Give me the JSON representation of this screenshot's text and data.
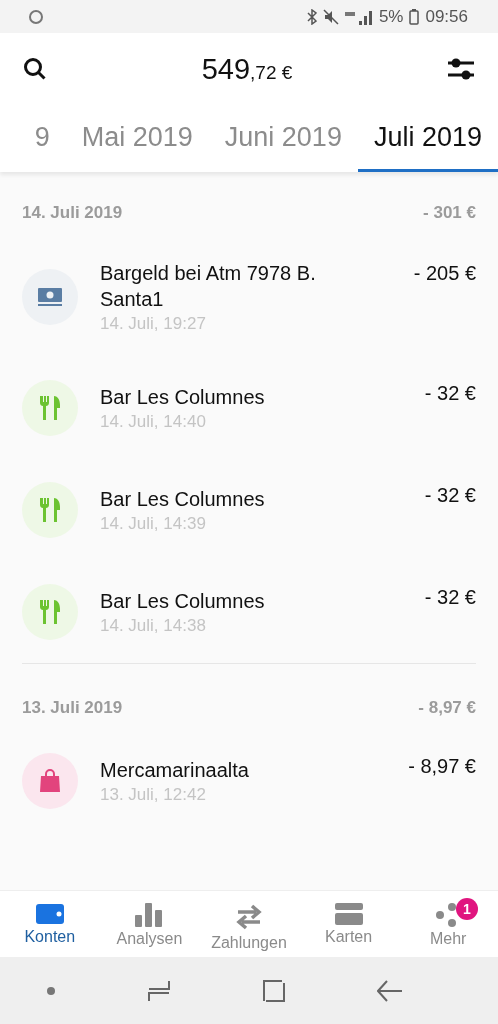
{
  "status_bar": {
    "battery": "5%",
    "time": "09:56"
  },
  "header": {
    "balance_main": "549",
    "balance_cents": ",72 €"
  },
  "tabs": [
    {
      "label": "9",
      "selected": false
    },
    {
      "label": "Mai 2019",
      "selected": false
    },
    {
      "label": "Juni 2019",
      "selected": false
    },
    {
      "label": "Juli 2019",
      "selected": true
    }
  ],
  "groups": [
    {
      "date": "14. Juli 2019",
      "total": "- 301 €",
      "transactions": [
        {
          "kind": "cash",
          "title": "Bargeld bei Atm 7978 B. Santa1",
          "time": "14. Juli, 19:27",
          "amount": "- 205 €"
        },
        {
          "kind": "food",
          "title": "Bar Les Columnes",
          "time": "14. Juli, 14:40",
          "amount": "- 32 €"
        },
        {
          "kind": "food",
          "title": "Bar Les Columnes",
          "time": "14. Juli, 14:39",
          "amount": "- 32 €"
        },
        {
          "kind": "food",
          "title": "Bar Les Columnes",
          "time": "14. Juli, 14:38",
          "amount": "- 32 €"
        }
      ]
    },
    {
      "date": "13. Juli 2019",
      "total": "- 8,97 €",
      "transactions": [
        {
          "kind": "shopping",
          "title": "Mercamarinaalta",
          "time": "13. Juli, 12:42",
          "amount": "- 8,97 €"
        }
      ]
    }
  ],
  "bottom_nav": [
    {
      "kind": "wallet",
      "label": "Konten",
      "selected": true
    },
    {
      "kind": "chart",
      "label": "Analysen",
      "selected": false
    },
    {
      "kind": "transfer",
      "label": "Zahlungen",
      "selected": false
    },
    {
      "kind": "card",
      "label": "Karten",
      "selected": false
    },
    {
      "kind": "more",
      "label": "Mehr",
      "selected": false,
      "badge": "1"
    }
  ]
}
